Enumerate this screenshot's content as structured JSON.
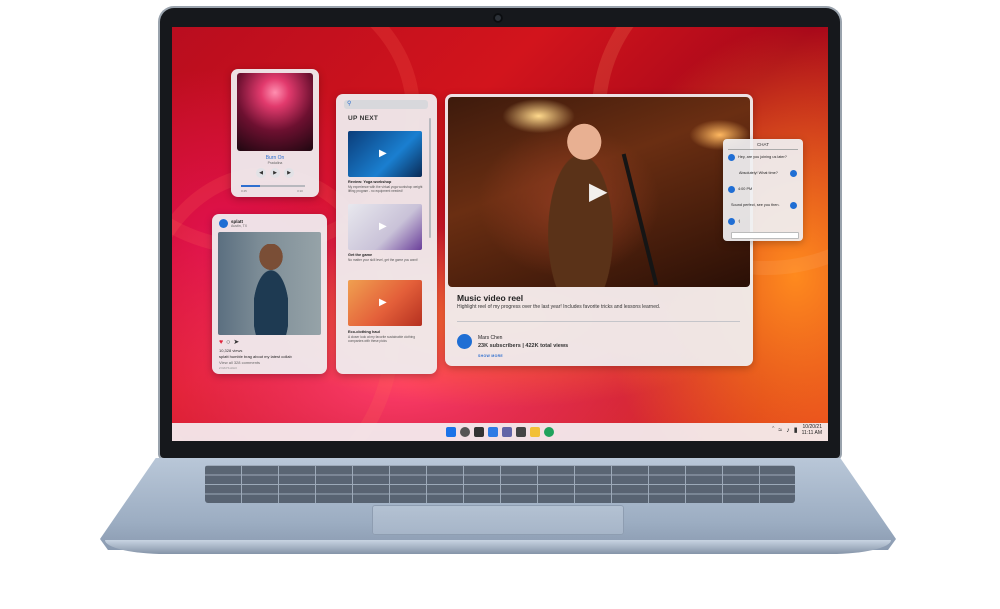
{
  "music": {
    "title": "Burn On",
    "artist": "Pradalina",
    "time_start": "0:45",
    "time_end": "3:10",
    "progress": 0.3
  },
  "post": {
    "username": "splatt",
    "location": "Austin, TX",
    "views": "10,328 views",
    "caption": "splatt humble brag about my latest collab",
    "comments": "View all 328 comments",
    "ago": "2 DAYS AGO"
  },
  "upnext": {
    "heading": "UP NEXT",
    "videos": [
      {
        "title": "Review: Yoga workshop",
        "desc": "My experience with the virtual yoga workshop weight lifting program - no equipment needed!"
      },
      {
        "title": "Get the game",
        "desc": "No matter your skill level, get the game you want!"
      },
      {
        "title": "Eco-clothing haul",
        "desc": "A closer look at my favorite sustainable clothing companies with these picks"
      }
    ]
  },
  "player": {
    "title": "Music video reel",
    "description": "Highlight reel of my progress over the last year! Includes favorite tricks and lessons learned.",
    "channel": "Mars Chen",
    "stats": "23K subscribers | 422K total views",
    "show_more": "SHOW MORE"
  },
  "chat": {
    "title": "CHAT",
    "messages": [
      {
        "text": "Hey, are you joining us later?"
      },
      {
        "text": "Absolutely! What time?"
      },
      {
        "text": "4:00 PM"
      },
      {
        "text": "Sound perfect, see you then."
      },
      {
        "text": ":)"
      }
    ]
  },
  "taskbar": {
    "date": "10/20/21",
    "time": "11:11 AM"
  },
  "colors": {
    "accent": "#1f6ed4",
    "link": "#2f6fcf"
  }
}
